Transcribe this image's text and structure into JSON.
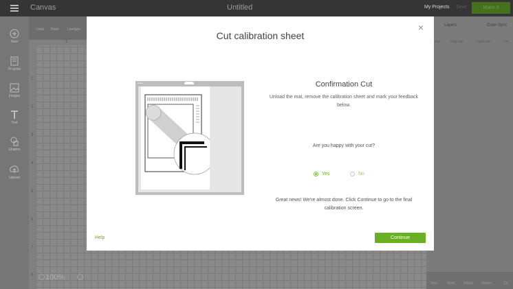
{
  "topbar": {
    "app_title": "Canvas",
    "doc_title": "Untitled",
    "my_projects": "My Projects",
    "save_label": "Save",
    "make_label": "Make It"
  },
  "leftbar": {
    "items": [
      {
        "label": "New",
        "icon": "plus-circle-icon"
      },
      {
        "label": "Projects",
        "icon": "projects-icon"
      },
      {
        "label": "Images",
        "icon": "images-icon"
      },
      {
        "label": "Text",
        "icon": "text-icon"
      },
      {
        "label": "Shapes",
        "icon": "shapes-icon"
      },
      {
        "label": "Upload",
        "icon": "upload-icon"
      }
    ]
  },
  "subtoolbar": {
    "undo": "Undo",
    "redo": "Redo",
    "linetype": "Linetype"
  },
  "canvas": {
    "ruler_top": [
      "1"
    ],
    "ruler_left": [
      "1",
      "2",
      "3",
      "4",
      "5",
      "6",
      "7",
      "8"
    ],
    "zoom": "100%"
  },
  "rightpanel": {
    "tabs": [
      "Layers",
      "Color Sync"
    ],
    "tools": [
      "Group",
      "Ungroup",
      "Duplicate",
      "Del"
    ],
    "bottom_tools": [
      "Slice",
      "Weld",
      "Attach",
      "Flatten",
      "Co"
    ]
  },
  "modal": {
    "title": "Cut calibration sheet",
    "close": "×",
    "illustration_logo": "Cricut",
    "confirmation_title": "Confirmation Cut",
    "description": "Unload the mat, remove the calibration sheet and mark your feedback below.",
    "question": "Are you happy with your cut?",
    "options": [
      {
        "label": "Yes",
        "selected": true
      },
      {
        "label": "No",
        "selected": false
      }
    ],
    "great_news": "Great news! We're almost done. Click Continue to go to the final calibration screen.",
    "help_label": "Help",
    "continue_label": "Continue",
    "accent_color": "#6ab023"
  }
}
